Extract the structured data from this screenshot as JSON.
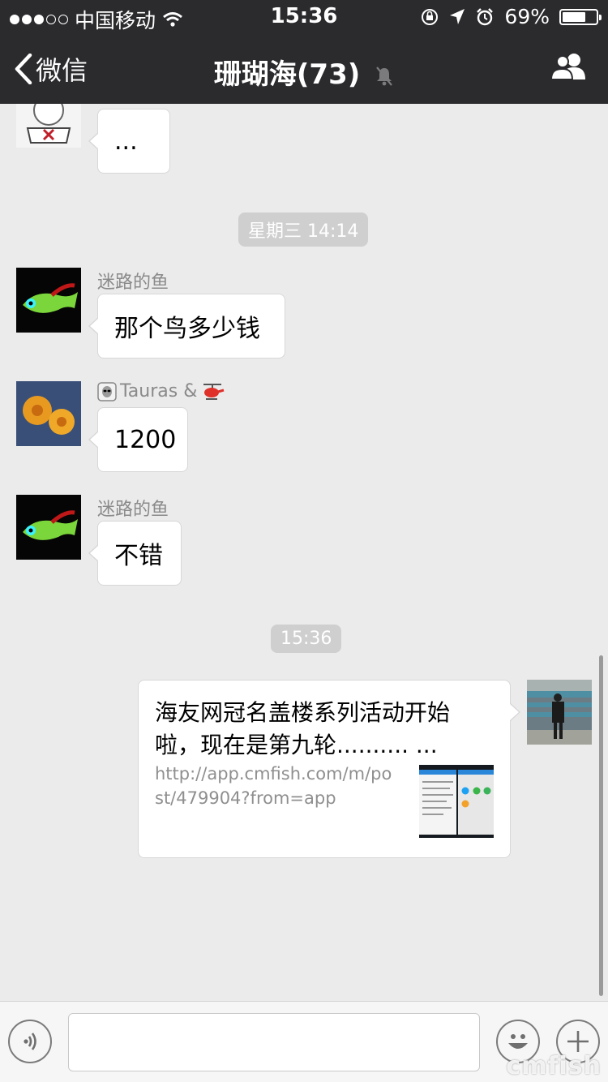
{
  "status": {
    "carrier": "中国移动",
    "time": "15:36",
    "battery": "69%",
    "battery_level": 0.69
  },
  "nav": {
    "back_label": "微信",
    "title": "珊瑚海(73)"
  },
  "chat": {
    "first_bubble": "...",
    "ts1": "星期三 14:14",
    "msg1": {
      "sender": "迷路的鱼",
      "text": "那个鸟多少钱"
    },
    "msg2": {
      "sender": "Tauras &",
      "text": "1200"
    },
    "msg3": {
      "sender": "迷路的鱼",
      "text": "不错"
    },
    "ts2": "15:36",
    "link": {
      "title": "海友网冠名盖楼系列活动开始啦，现在是第九轮.......... ...",
      "url": "http://app.cmfish.com/m/post/479904?from=app"
    }
  },
  "input": {
    "value": "",
    "placeholder": ""
  },
  "watermark": "cmfish",
  "colors": {
    "bar": "#2b2b2e",
    "background": "#ebebeb"
  }
}
